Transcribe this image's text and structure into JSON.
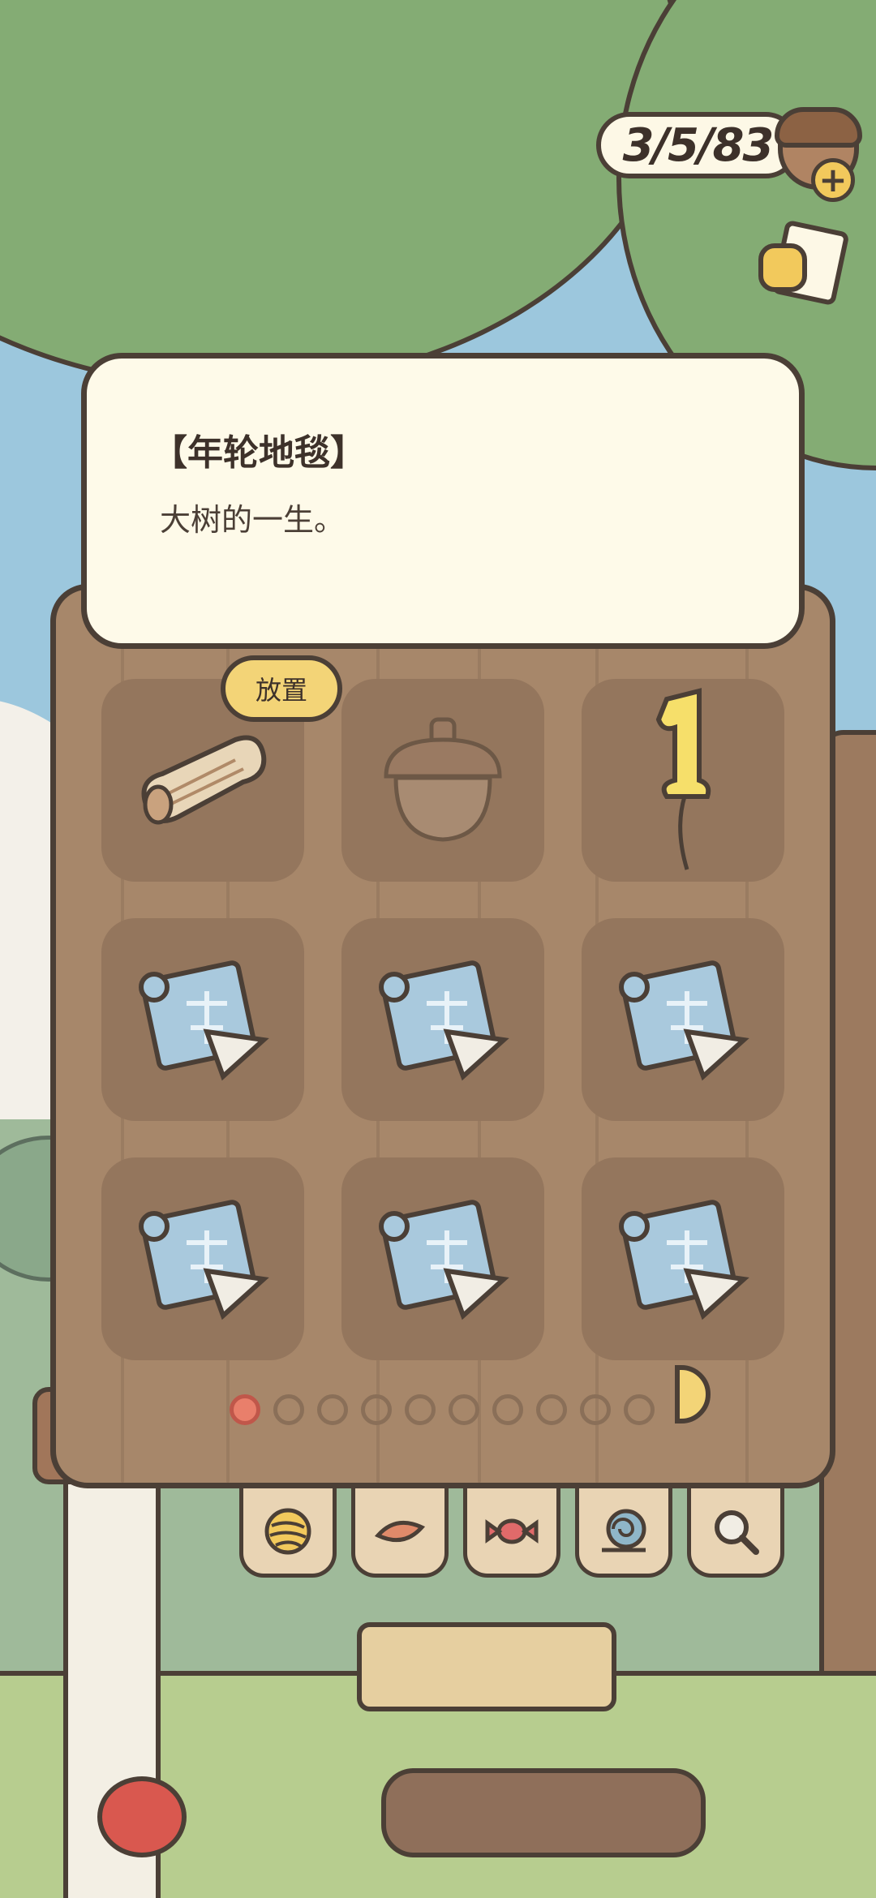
{
  "currency": {
    "value": "315183",
    "display": "3/5/83",
    "add_icon": "plus-icon"
  },
  "hint_button": {
    "icon": "note-hand-icon"
  },
  "item_detail": {
    "title": "【年轮地毯】",
    "description": "大树的一生。"
  },
  "inventory": {
    "place_label": "放置",
    "selected_slot": 0,
    "slots": [
      {
        "icon": "tree-ring-carpet-icon"
      },
      {
        "icon": "acorn-icon"
      },
      {
        "icon": "number-one-balloon-icon"
      },
      {
        "icon": "blueprint-icon"
      },
      {
        "icon": "blueprint-icon"
      },
      {
        "icon": "blueprint-icon"
      },
      {
        "icon": "blueprint-icon"
      },
      {
        "icon": "blueprint-icon"
      },
      {
        "icon": "blueprint-icon"
      }
    ],
    "pages_total": 10,
    "current_page": 1
  },
  "category_tabs": [
    {
      "icon": "yarn-ball-icon"
    },
    {
      "icon": "leaf-icon"
    },
    {
      "icon": "candy-icon"
    },
    {
      "icon": "snail-shell-icon"
    },
    {
      "icon": "magnifier-icon"
    }
  ],
  "colors": {
    "outline": "#4b3f36",
    "panel_wood": "#a7876a",
    "slot_bg": "#94765d",
    "card_bg": "#fefae9",
    "accent_yellow": "#f3d477",
    "active_dot": "#e97f6b"
  }
}
